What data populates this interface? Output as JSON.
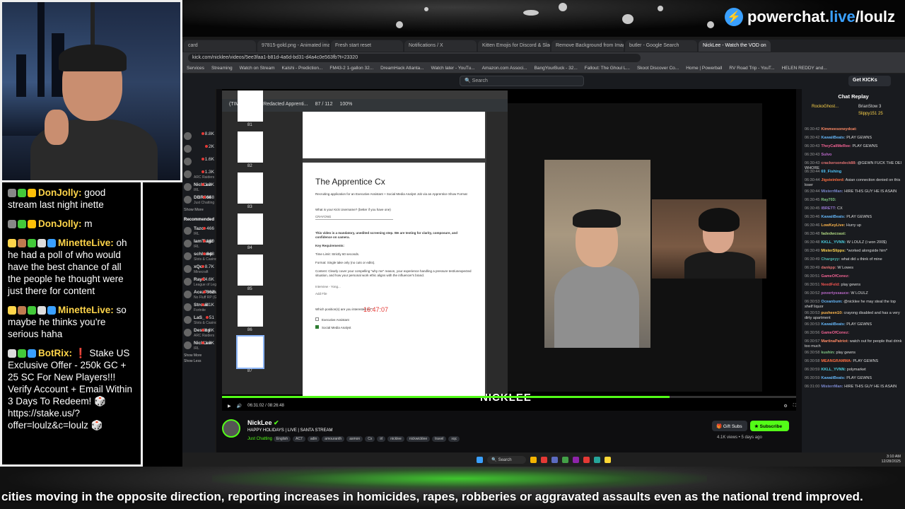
{
  "overlay": {
    "brand_prefix": "powerchat.",
    "brand_live": "live",
    "brand_suffix": "/loulz",
    "ticker_text": "cities moving in the opposite direction, reporting increases in homicides, rapes, robberies or aggravated assaults even as the national trend improved."
  },
  "chat": [
    {
      "user": "DonJolly:",
      "color": "#ffd54a",
      "text": "good stream last night inette",
      "badges": [
        "#888",
        "#43c93a",
        "#ffc107"
      ]
    },
    {
      "user": "DonJolly:",
      "color": "#ffd54a",
      "text": "m",
      "badges": [
        "#888",
        "#43c93a",
        "#ffc107"
      ]
    },
    {
      "user": "MinetteLive:",
      "color": "#ffd54a",
      "text": "oh he had a poll of who would have the best chance of all the people he thought were just there for content",
      "badges": [
        "#ffd54a",
        "#c07a4f",
        "#43c93a",
        "#ddd",
        "#3aa0ff"
      ]
    },
    {
      "user": "MinetteLive:",
      "color": "#ffd54a",
      "text": "so maybe he thinks you're serious haha",
      "badges": [
        "#ffd54a",
        "#c07a4f",
        "#43c93a",
        "#ddd",
        "#3aa0ff"
      ]
    },
    {
      "user": "BotRix:",
      "color": "#ffd54a",
      "text": "❗ Stake US Exclusive Offer - 250k GC + 25 SC For New Players!!! Verify Account + Email Within 3 Days To Redeem! 🎲 https://stake.us/?offer=loulz&c=loulz 🎲",
      "badges": [
        "#ddd",
        "#43c93a",
        "#3aa0ff"
      ]
    }
  ],
  "browser": {
    "tabs": [
      "card",
      "97815-gold.png - Animated image",
      "Fresh start reset",
      "Notifications / X",
      "Kitten Emojis for Discord & Slack",
      "Remove Background from Image fo",
      "butler - Google Search",
      "NickLee - Watch the VOD on"
    ],
    "url": "kick.com/nicklee/videos/5ee3faa1-b81d-4a6d-bd31-d4a4c0e563fb?t=23320",
    "bookmarks": [
      "Services",
      "Streaming",
      "Watch on Stream",
      "Kalshi - Prediction...",
      "FM43-2 1-gallon 32...",
      "DreamHack Atlanta...",
      "Watch later - YouTu...",
      "Amazon.com Associ...",
      "BangYourBuck - 32...",
      "Fallout: The Ghoul L...",
      "Skoot Discover Co...",
      "Home | Powerball",
      "RV Road Trip - YouT...",
      "HELEN REDDY and..."
    ],
    "search_placeholder": "Search",
    "get_kicks": "Get KICKs"
  },
  "sidebar": {
    "following": [
      {
        "name": "",
        "cat": "",
        "count": "8.8K"
      },
      {
        "name": "",
        "cat": "",
        "count": "2K"
      },
      {
        "name": "",
        "cat": "",
        "count": "1.6K"
      },
      {
        "name": "",
        "cat": "ARC Raiders",
        "count": "1.3K"
      },
      {
        "name": "NickLee",
        "cat": "IRL",
        "count": "1.2K"
      },
      {
        "name": "DBR666",
        "cat": "Just Chatting",
        "count": "648"
      }
    ],
    "show_more": "Show More",
    "recommended_label": "Recommended",
    "recommended": [
      {
        "name": "Tazo",
        "cat": "IRL",
        "count": "466"
      },
      {
        "name": "IamTiagz",
        "cat": "IRL",
        "count": "180"
      },
      {
        "name": "schlump",
        "cat": "Slots & Casino",
        "count": "848"
      },
      {
        "name": "xQc",
        "cat": "Minecraft",
        "count": "8.7K"
      },
      {
        "name": "RayC",
        "cat": "League of Legends",
        "count": "4.6K"
      },
      {
        "name": "AcezProduction",
        "cat": "No Fluff RP (GTA)",
        "count": "362"
      },
      {
        "name": "Stroud",
        "cat": "Fortnite",
        "count": "6.1K"
      },
      {
        "name": "LaS_",
        "cat": "Slots & Casino",
        "count": "51"
      },
      {
        "name": "Destiny",
        "cat": "ARC Raiders",
        "count": "1.6K"
      },
      {
        "name": "NickLee",
        "cat": "IRL",
        "count": "1.3K"
      }
    ],
    "show_more2": "Show More",
    "show_less": "Show Less"
  },
  "pdf": {
    "tabbar": "(TIMECODES) Redacted Apprenti...",
    "page_current": "87",
    "page_total": "/ 112",
    "zoom": "100%",
    "thumb_nums": [
      "81",
      "82",
      "83",
      "84",
      "85",
      "86",
      "87"
    ],
    "doc_title": "The Apprentice Cx",
    "doc_sub": "Recruiting application for an Executive Assistant + Social Media Analyst Job via an Apprentice Show Format",
    "q1": "What is your Kick Username? (better if you have one)",
    "q1_answer": "CRAYONG",
    "p1": "This video is a mandatory, unedited screening step. We are testing for clarity, composure, and confidence on camera.",
    "key_req": "Key Requirements:",
    "time_limit": "Time Limit: Strictly 60 seconds.",
    "format": "Format: Single take only (no cuts or edits).",
    "content": "Content: Clearly cover your compelling \"why me\" reason, your experience handling a pressure test/unexpected situation, and how your personal work ethic aligns with the influencer's brand.",
    "attachment": "Interview - Yong...",
    "add_file": "Add File",
    "q2": "Which position(s) are you interested in? *",
    "opt1": "Executive Assistant",
    "opt2": "Social Media Analyst",
    "timestamp": "16:47:07"
  },
  "player": {
    "time": "06:31:02 / 08:26:48",
    "progress": 0.78,
    "watermark": "NICKLEE"
  },
  "channel": {
    "name": "NickLee",
    "title": "HAPPY HOLIDAYS | LIVE | SANTA STREAM",
    "category": "Just Chatting",
    "tags": [
      "English",
      "AC7",
      "adin",
      "amouranth",
      "asmon",
      "Cx",
      "irl",
      "nicklee",
      "nickwicklee",
      "travel",
      "xqc"
    ],
    "gift_subs": "Gift Subs",
    "subscribe": "Subscribe",
    "views": "4.1K views • 5 days ago"
  },
  "chat_replay": {
    "title": "Chat Replay",
    "top_gifters": [
      "RockoGhost...",
      "BrianStow 3",
      "Slippy151 25"
    ],
    "messages": [
      {
        "time": "06:30:42",
        "user": "Kimmeesoneydcat:",
        "ucolor": "#ff8a65",
        "text": ""
      },
      {
        "time": "06:30:42",
        "user": "KawaiiBeats:",
        "ucolor": "#64b5f6",
        "text": "PLAY GEWNS"
      },
      {
        "time": "06:30:43",
        "user": "TheyCallMeRee:",
        "ucolor": "#f06292",
        "text": "PLAY GEWNS"
      },
      {
        "time": "06:30:43",
        "user": "Sulvo",
        "ucolor": "#ba68c8",
        "text": ""
      },
      {
        "time": "06:30:43",
        "user": "crackersondeck88:",
        "ucolor": "#e57373",
        "text": "@GEWN FUCK THE DEI WHORE"
      },
      {
        "time": "06:30:44",
        "user": "69_Fishing",
        "ucolor": "#4fc3f7",
        "text": ""
      },
      {
        "time": "06:30:44",
        "user": "Jigsteinlord:",
        "ucolor": "#ff7043",
        "text": "Asian connection denied on this loser"
      },
      {
        "time": "06:30:44",
        "user": "MisterrMan:",
        "ucolor": "#7986cb",
        "text": "HIRE THIS GUY HE IS ASAIN"
      },
      {
        "time": "06:30:45",
        "user": "Ray703:",
        "ucolor": "#81c784",
        "text": ""
      },
      {
        "time": "06:30:45",
        "user": "IBRETT:",
        "ucolor": "#9575cd",
        "text": "CX"
      },
      {
        "time": "06:30:46",
        "user": "KawaiiBeats:",
        "ucolor": "#64b5f6",
        "text": "PLAY GEWNS"
      },
      {
        "time": "06:30:46",
        "user": "LowKeyLive:",
        "ucolor": "#ffb74d",
        "text": "Hurry up"
      },
      {
        "time": "06:30:48",
        "user": "fadedwcoast:",
        "ucolor": "#aed581",
        "text": ""
      },
      {
        "time": "06:30:48",
        "user": "KKLL_YVNN:",
        "ucolor": "#4dd0e1",
        "text": "W LOULZ (i won 200$)"
      },
      {
        "time": "06:30:49",
        "user": "MisterSlipps:",
        "ucolor": "#ffd54f",
        "text": "*worked alongside him*"
      },
      {
        "time": "06:30:49",
        "user": "Chargeyy:",
        "ucolor": "#4db6ac",
        "text": "what did u think of mine"
      },
      {
        "time": "06:30:49",
        "user": "dankpp:",
        "ucolor": "#e57373",
        "text": "W Lowes"
      },
      {
        "time": "06:30:51",
        "user": "GameOfConez:",
        "ucolor": "#f06292",
        "text": ""
      },
      {
        "time": "06:30:51",
        "user": "NeedFeld:",
        "ucolor": "#ef5350",
        "text": "play gewns"
      },
      {
        "time": "06:30:52",
        "user": "povertyssauce:",
        "ucolor": "#ba68c8",
        "text": "W LOULZ"
      },
      {
        "time": "06:30:53",
        "user": "Oceanbum:",
        "ucolor": "#64b5f6",
        "text": "@nicklee he may steal the top shelf liquor"
      },
      {
        "time": "06:30:53",
        "user": "pusheen10:",
        "ucolor": "#ffb74d",
        "text": "crayong disabled and has a very dirty apartment"
      },
      {
        "time": "06:30:53",
        "user": "KawaiiBeats:",
        "ucolor": "#64b5f6",
        "text": "PLAY GEWNS"
      },
      {
        "time": "06:30:56",
        "user": "GameOfConez:",
        "ucolor": "#f06292",
        "text": ""
      },
      {
        "time": "06:30:57",
        "user": "MartinaPatriot:",
        "ucolor": "#ff8a65",
        "text": "watch out for people that drink too much"
      },
      {
        "time": "06:30:58",
        "user": "kushin:",
        "ucolor": "#81c784",
        "text": "play gewns"
      },
      {
        "time": "06:30:58",
        "user": "MEANGRAMMA:",
        "ucolor": "#ff7043",
        "text": "PLAY GEWNS"
      },
      {
        "time": "06:30:59",
        "user": "KKLL_YVNN:",
        "ucolor": "#4dd0e1",
        "text": "polymarket"
      },
      {
        "time": "06:30:59",
        "user": "KawaiiBeats:",
        "ucolor": "#64b5f6",
        "text": "PLAY GEWNS"
      },
      {
        "time": "06:31:00",
        "user": "MisterrMan:",
        "ucolor": "#7986cb",
        "text": "HIRE THIS GUY HE IS ASAIN"
      }
    ]
  },
  "taskbar": {
    "search": "Search",
    "time": "3:10 AM",
    "date": "12/28/2025"
  }
}
